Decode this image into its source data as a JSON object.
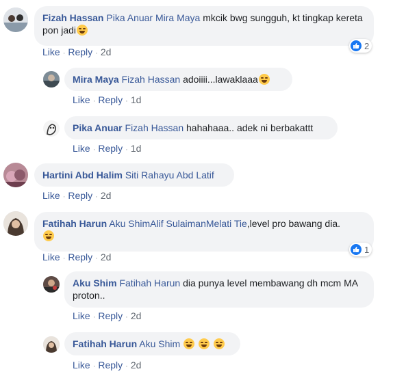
{
  "comments": [
    {
      "author": "Fizah Hassan",
      "text_parts": [
        "Pika Anuar",
        "Mira Maya",
        "mkcik bwg sungguh, kt tingkap kereta pon jadi"
      ],
      "actions": {
        "like": "Like",
        "reply": "Reply",
        "time": "2d"
      },
      "reactions": "2"
    },
    {
      "author": "Mira Maya",
      "tag": "Fizah Hassan",
      "text": "adoiiii...lawaklaaa",
      "actions": {
        "like": "Like",
        "reply": "Reply",
        "time": "1d"
      }
    },
    {
      "author": "Pika Anuar",
      "tag": "Fizah Hassan",
      "text": "hahahaaa.. adek ni berbakattt",
      "actions": {
        "like": "Like",
        "reply": "Reply",
        "time": "1d"
      }
    },
    {
      "author": "Hartini Abd Halim",
      "tag": "Siti Rahayu Abd Latif",
      "actions": {
        "like": "Like",
        "reply": "Reply",
        "time": "2d"
      }
    },
    {
      "author": "Fatihah Harun",
      "text_parts": [
        "Aku Shim",
        "Alif Sulaiman",
        "Melati Tie",
        ",level pro bawang dia."
      ],
      "actions": {
        "like": "Like",
        "reply": "Reply",
        "time": "2d"
      },
      "reactions": "1"
    },
    {
      "author": "Aku Shim",
      "tag": "Fatihah Harun",
      "text": "dia punya level membawang dh mcm MA proton..",
      "actions": {
        "like": "Like",
        "reply": "Reply",
        "time": "2d"
      }
    },
    {
      "author": "Fatihah Harun",
      "tag": "Aku Shim",
      "actions": {
        "like": "Like",
        "reply": "Reply",
        "time": "2d"
      }
    }
  ],
  "colors": {
    "link": "#385898",
    "bubble": "#f2f3f5",
    "meta": "#606770",
    "like_blue": "#1877f2"
  },
  "icons": {
    "reaction": "like-thumb-icon",
    "emoji": "laughing-emoji-icon"
  }
}
